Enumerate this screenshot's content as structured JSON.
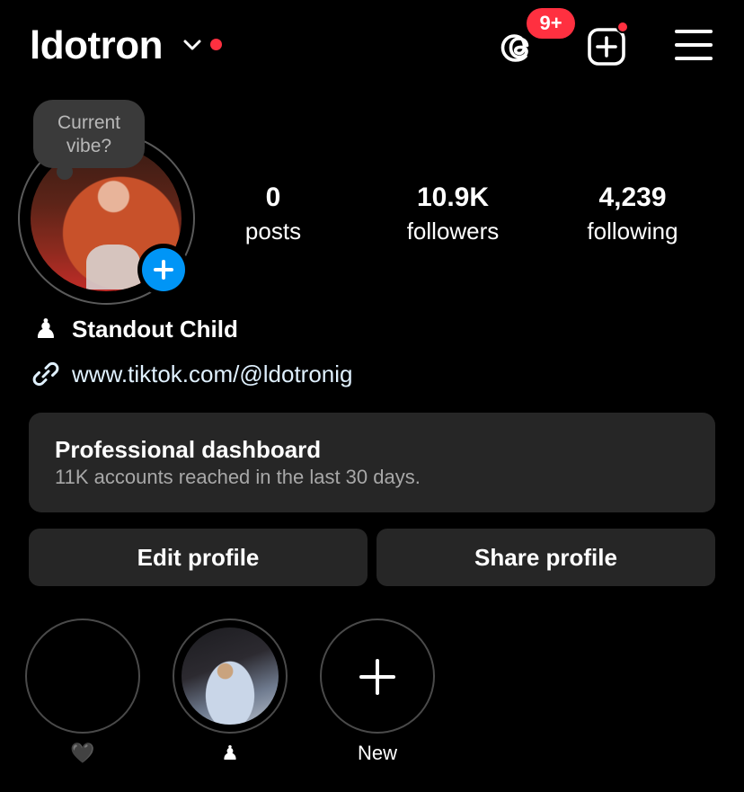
{
  "header": {
    "username": "ldotron",
    "threads_badge": "9+",
    "icons": {
      "dropdown": "chevron-down-icon",
      "threads": "threads-icon",
      "create": "plus-square-icon",
      "menu": "hamburger-menu-icon"
    }
  },
  "profile": {
    "note_bubble": "Current vibe?",
    "stats": {
      "posts": {
        "value": "0",
        "label": "posts"
      },
      "followers": {
        "value": "10.9K",
        "label": "followers"
      },
      "following": {
        "value": "4,239",
        "label": "following"
      }
    },
    "bio": {
      "emoji": "♟",
      "display_name": "Standout Child",
      "link": "www.tiktok.com/@ldotronig"
    }
  },
  "dashboard": {
    "title": "Professional dashboard",
    "subtitle": "11K accounts reached in the last 30 days."
  },
  "actions": {
    "edit": "Edit profile",
    "share": "Share profile"
  },
  "highlights": [
    {
      "label": "🖤"
    },
    {
      "label": "♟"
    },
    {
      "label": "New"
    }
  ],
  "colors": {
    "background": "#000000",
    "notification": "#ff3040",
    "accent_blue": "#0095f6",
    "button_bg": "#262626",
    "secondary_text": "#a8a8a8"
  }
}
